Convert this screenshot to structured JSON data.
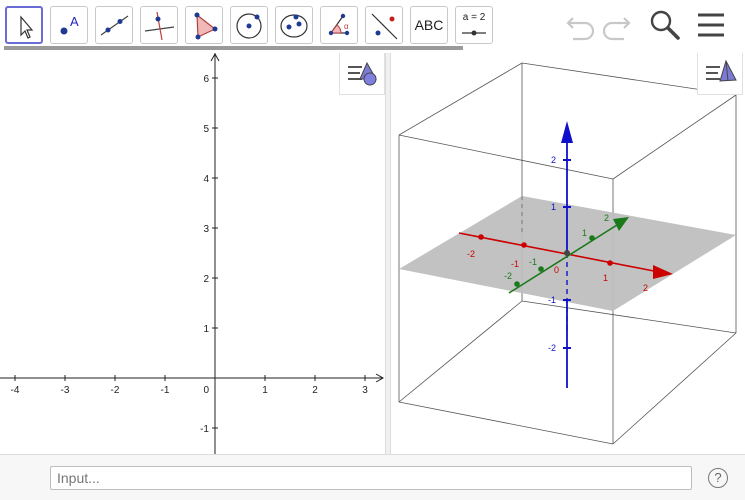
{
  "toolbar": {
    "tools": [
      {
        "name": "move-tool-icon",
        "active": true
      },
      {
        "name": "point-tool-icon"
      },
      {
        "name": "line-tool-icon"
      },
      {
        "name": "perpendicular-line-tool-icon"
      },
      {
        "name": "polygon-tool-icon"
      },
      {
        "name": "circle-tool-icon"
      },
      {
        "name": "conic-tool-icon"
      },
      {
        "name": "angle-tool-icon"
      },
      {
        "name": "reflect-tool-icon"
      },
      {
        "name": "text-tool-icon",
        "label": "ABC"
      },
      {
        "name": "slider-tool-icon",
        "label": "a = 2"
      }
    ],
    "point_tool_label": "A",
    "text_tool_label": "ABC",
    "slider_tool_label": "a = 2"
  },
  "graphics2d": {
    "x_ticks": [
      -4,
      -3,
      -2,
      -1,
      1,
      2,
      3
    ],
    "y_ticks": [
      -1,
      1,
      2,
      3,
      4,
      5,
      6
    ],
    "origin_label": "0"
  },
  "graphics3d": {
    "z_ticks_up": [
      "2",
      "1"
    ],
    "z_ticks_down": [
      "-1",
      "-2"
    ],
    "x_ticks_pos": [
      "1",
      "2"
    ],
    "x_ticks_neg": [
      "-1",
      "-2"
    ],
    "y_ticks_pos": [
      "1",
      "2"
    ],
    "y_ticks_neg": [
      "-1",
      "-2"
    ],
    "origin_label": "0",
    "colors": {
      "x_axis": "#cc0000",
      "y_axis": "#1a7a1a",
      "z_axis": "#1010cc",
      "plane": "#bfbfbf"
    }
  },
  "input": {
    "placeholder": "Input..."
  },
  "help": {
    "label": "?"
  }
}
